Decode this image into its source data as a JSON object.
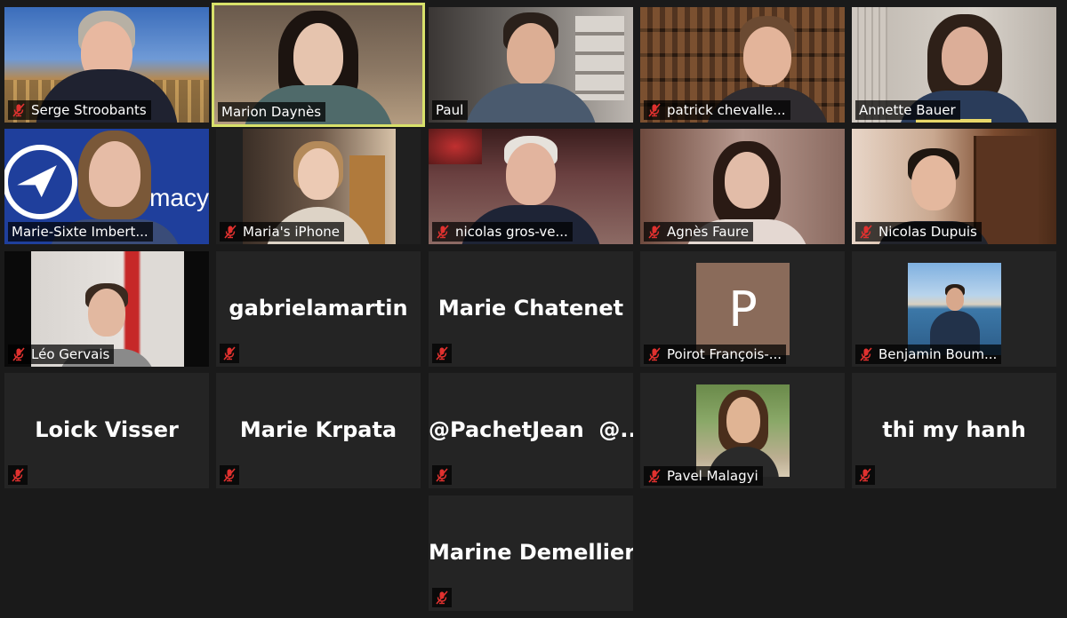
{
  "participants": [
    {
      "name": "Serge Stroobants"
    },
    {
      "name": "Marion Daynès"
    },
    {
      "name": "Paul"
    },
    {
      "name": "patrick chevalle..."
    },
    {
      "name": "Annette Bauer"
    },
    {
      "name": "Marie-Sixte Imbert..."
    },
    {
      "name": "Maria's iPhone"
    },
    {
      "name": "nicolas gros-ve..."
    },
    {
      "name": "Agnès Faure"
    },
    {
      "name": "Nicolas Dupuis"
    },
    {
      "name": "Léo Gervais"
    },
    {
      "display": "gabrielamartin"
    },
    {
      "display": "Marie Chatenet"
    },
    {
      "name": "Poirot François-...",
      "avatar_letter": "P"
    },
    {
      "name": "Benjamin Boum..."
    },
    {
      "display": "Loick Visser"
    },
    {
      "display": "Marie Krpata"
    },
    {
      "display": "@PachetJean  @..."
    },
    {
      "name": "Pavel Malagyi"
    },
    {
      "display": "thi my hanh"
    },
    {
      "display": "Marine Demellier"
    }
  ],
  "logo_text": "macy",
  "colors": {
    "background": "#1a1a1a",
    "tile": "#242424",
    "active_speaker_border": "#d8e16a",
    "muted_icon": "#e0312f"
  },
  "icons": {
    "muted": "mic-muted-icon"
  }
}
